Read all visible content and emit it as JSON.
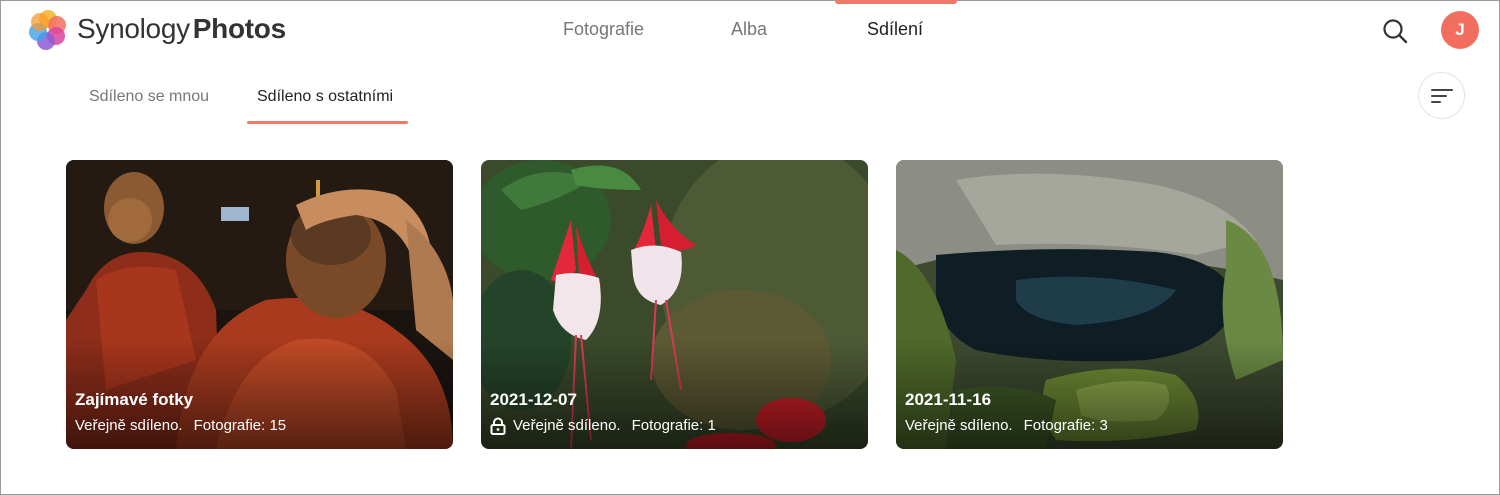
{
  "app": {
    "brand_light": "Synology",
    "brand_bold": "Photos",
    "logo_icon": "synology-photos-flower-logo"
  },
  "nav": {
    "tabs": [
      {
        "label": "Fotografie",
        "active": false
      },
      {
        "label": "Alba",
        "active": false
      },
      {
        "label": "Sdílení",
        "active": true
      }
    ],
    "accent_color": "#f07a6a"
  },
  "header_actions": {
    "search_icon": "search-icon",
    "avatar_initial": "J",
    "avatar_color": "#f26f5f"
  },
  "sub_tabs": [
    {
      "label": "Sdíleno se mnou",
      "active": false
    },
    {
      "label": "Sdíleno s ostatními",
      "active": true
    }
  ],
  "sort_icon": "sort-icon",
  "albums": [
    {
      "title": "Zajímavé fotky",
      "sharing": "Veřejně sdíleno.",
      "count": "Fotografie: 15",
      "locked": false
    },
    {
      "title": "2021-12-07",
      "sharing": "Veřejně sdíleno.",
      "count": "Fotografie: 1",
      "locked": true
    },
    {
      "title": "2021-11-16",
      "sharing": "Veřejně sdíleno.",
      "count": "Fotografie: 3",
      "locked": false
    }
  ]
}
